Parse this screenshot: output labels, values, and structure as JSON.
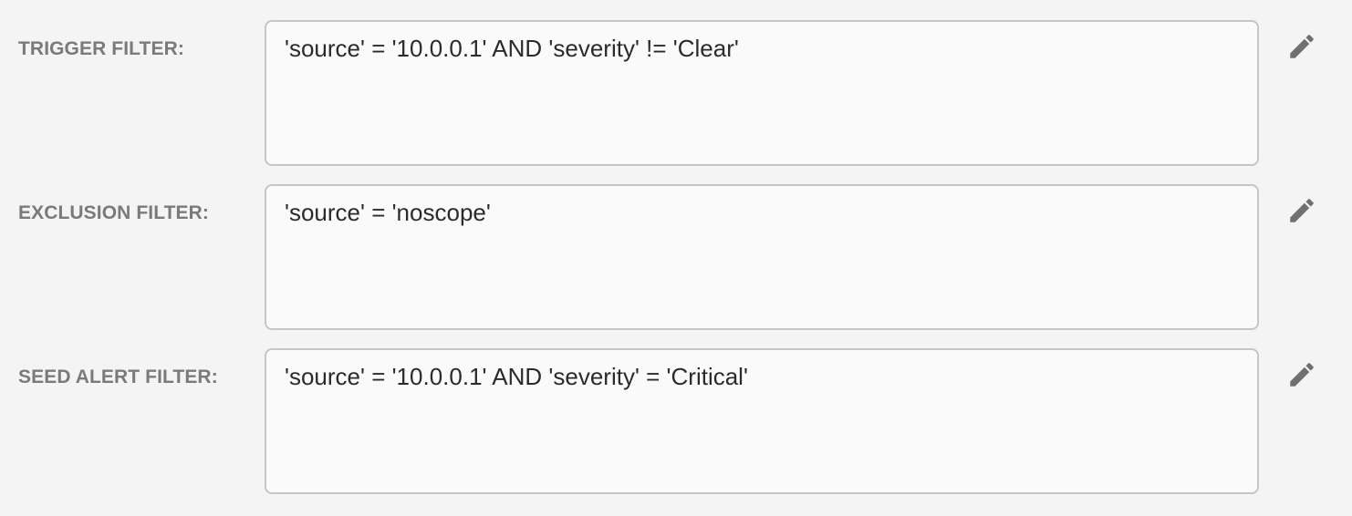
{
  "filters": [
    {
      "label": "TRIGGER FILTER:",
      "value": "'source' = '10.0.0.1' AND 'severity' != 'Clear'",
      "action_icon": "pencil-icon"
    },
    {
      "label": "EXCLUSION FILTER:",
      "value": "'source' = 'noscope'",
      "action_icon": "pencil-icon"
    },
    {
      "label": "SEED ALERT FILTER:",
      "value": "'source' = '10.0.0.1' AND 'severity' = 'Critical'",
      "action_icon": "pencil-icon"
    }
  ],
  "colors": {
    "background": "#f4f4f4",
    "field_background": "#fafafa",
    "field_border": "#c6c6c6",
    "label_text": "#7a7a7a",
    "value_text": "#2b2b2b",
    "icon": "#707070"
  }
}
